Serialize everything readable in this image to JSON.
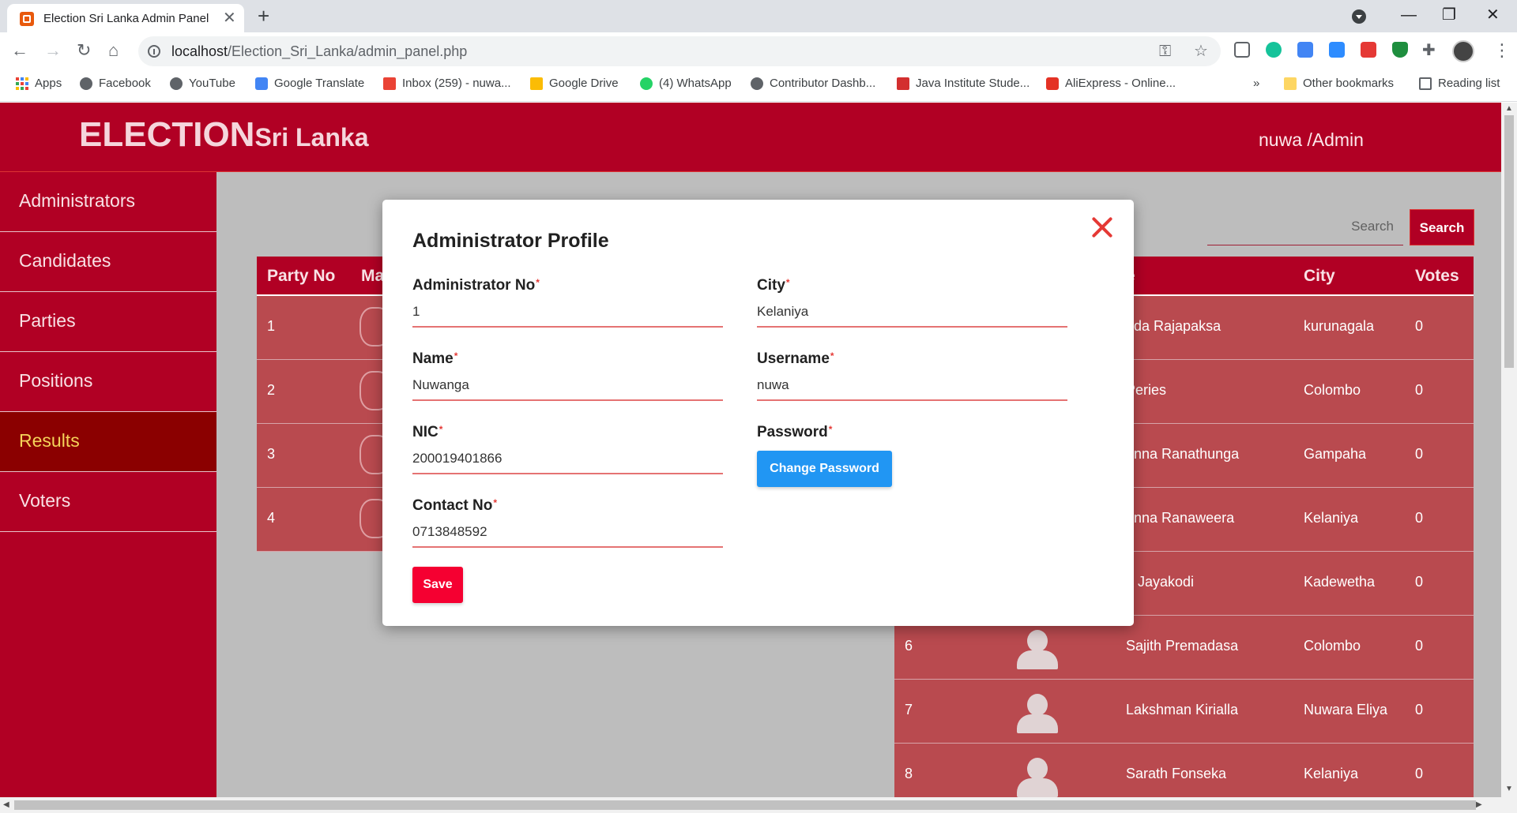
{
  "browser": {
    "tab_title": "Election Sri Lanka Admin Panel",
    "url_host": "localhost",
    "url_path": "/Election_Sri_Lanka/admin_panel.php",
    "bookmarks": [
      {
        "label": "Apps",
        "icon": "apps-grid-icon"
      },
      {
        "label": "Facebook",
        "icon": "globe-icon"
      },
      {
        "label": "YouTube",
        "icon": "globe-icon"
      },
      {
        "label": "Google Translate",
        "icon": "translate-icon"
      },
      {
        "label": "Inbox (259) - nuwa...",
        "icon": "gmail-icon"
      },
      {
        "label": "Google Drive",
        "icon": "drive-icon"
      },
      {
        "label": "(4) WhatsApp",
        "icon": "whatsapp-icon"
      },
      {
        "label": "Contributor Dashb...",
        "icon": "globe-icon"
      },
      {
        "label": "Java Institute Stude...",
        "icon": "java-icon"
      },
      {
        "label": "AliExpress - Online...",
        "icon": "aliexpress-icon"
      }
    ],
    "bookmarks_overflow": "»",
    "other_bookmarks": "Other bookmarks",
    "reading_list": "Reading list"
  },
  "header": {
    "brand_main": "ELECTION",
    "brand_sub": "Sri Lanka",
    "user_label": "nuwa /Admin"
  },
  "sidebar": {
    "items": [
      {
        "label": "Administrators",
        "active": false
      },
      {
        "label": "Candidates",
        "active": false
      },
      {
        "label": "Parties",
        "active": false
      },
      {
        "label": "Positions",
        "active": false
      },
      {
        "label": "Results",
        "active": true
      },
      {
        "label": "Voters",
        "active": false
      }
    ]
  },
  "search": {
    "placeholder": "Search",
    "button_label": "Search"
  },
  "results_table": {
    "columns": [
      "Party No",
      "Ma",
      "e",
      "City",
      "Votes"
    ],
    "party_rows": [
      {
        "party_no": "1"
      },
      {
        "party_no": "2"
      },
      {
        "party_no": "3"
      },
      {
        "party_no": "4"
      }
    ],
    "candidate_rows": [
      {
        "no": "",
        "name": "nda Rajapaksa",
        "city": "kurunagala",
        "votes": "0"
      },
      {
        "no": "",
        "name": "Peries",
        "city": "Colombo",
        "votes": "0"
      },
      {
        "no": "",
        "name": "anna Ranathunga",
        "city": "Gampaha",
        "votes": "0"
      },
      {
        "no": "",
        "name": "anna Ranaweera",
        "city": "Kelaniya",
        "votes": "0"
      },
      {
        "no": "",
        "name": "a Jayakodi",
        "city": "Kadewetha",
        "votes": "0"
      },
      {
        "no": "6",
        "name": "Sajith Premadasa",
        "city": "Colombo",
        "votes": "0"
      },
      {
        "no": "7",
        "name": "Lakshman Kirialla",
        "city": "Nuwara Eliya",
        "votes": "0"
      },
      {
        "no": "8",
        "name": "Sarath Fonseka",
        "city": "Kelaniya",
        "votes": "0"
      }
    ]
  },
  "modal": {
    "title": "Administrator Profile",
    "required_mark": "*",
    "fields": {
      "admin_no": {
        "label": "Administrator No",
        "value": "1"
      },
      "name": {
        "label": "Name",
        "value": "Nuwanga"
      },
      "nic": {
        "label": "NIC",
        "value": "200019401866"
      },
      "contact_no": {
        "label": "Contact No",
        "value": "0713848592"
      },
      "city": {
        "label": "City",
        "value": "Kelaniya"
      },
      "username": {
        "label": "Username",
        "value": "nuwa"
      },
      "password": {
        "label": "Password"
      }
    },
    "change_password_label": "Change Password",
    "save_label": "Save"
  },
  "colors": {
    "brand_red": "#b10024",
    "active_item_bg": "#8b0000",
    "active_item_text": "#f5d35a",
    "table_row": "#b94a4f",
    "change_password_blue": "#2196f3",
    "save_red": "#f50031",
    "close_red": "#e53935"
  }
}
